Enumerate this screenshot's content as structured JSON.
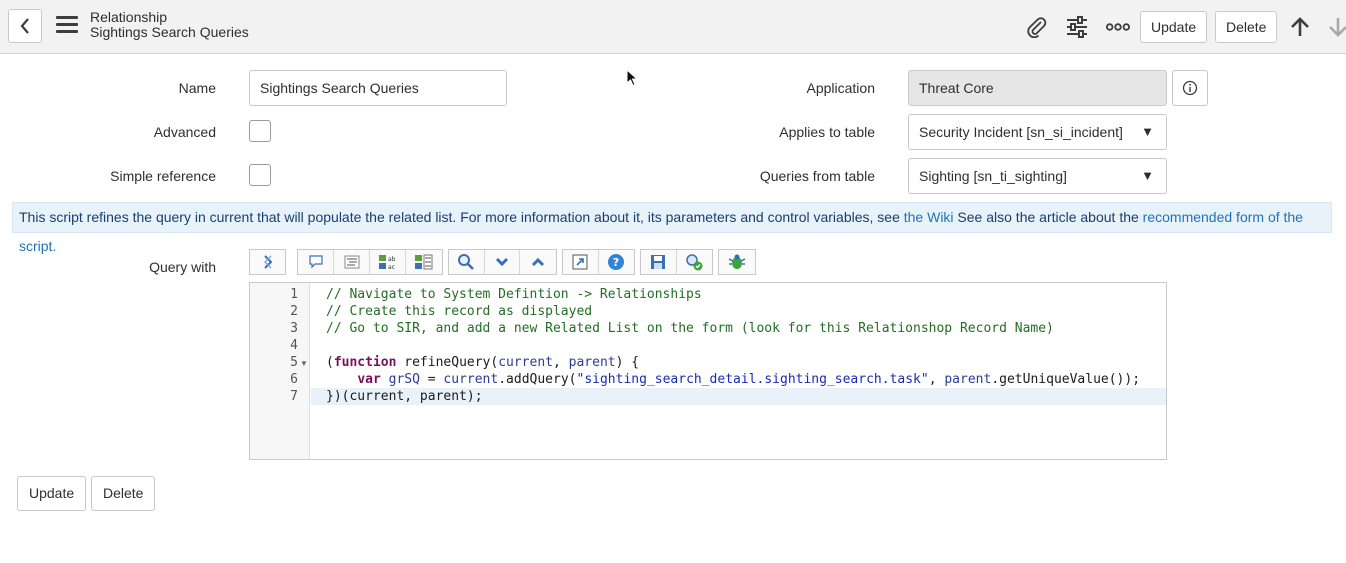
{
  "header": {
    "title_line1": "Relationship",
    "title_line2": "Sightings Search Queries",
    "update_label": "Update",
    "delete_label": "Delete",
    "icons": [
      "chevron-left-icon",
      "hamburger-menu-icon",
      "paperclip-icon",
      "sliders-icon",
      "more-icon",
      "arrow-up-icon",
      "arrow-down-icon"
    ]
  },
  "form": {
    "name_label": "Name",
    "name_value": "Sightings Search Queries",
    "advanced_label": "Advanced",
    "simple_reference_label": "Simple reference",
    "application_label": "Application",
    "application_value": "Threat Core",
    "applies_to_label": "Applies to table",
    "applies_to_value": "Security Incident [sn_si_incident]",
    "queries_from_label": "Queries from table",
    "queries_from_value": "Sighting [sn_ti_sighting]",
    "advanced_checked": false,
    "simple_reference_checked": false
  },
  "info": {
    "text1": "This script refines the query in current that will populate the related list. For more information about it, its parameters and control variables, see ",
    "link1": "the Wiki",
    "text2": " See also the article about the ",
    "link2": "recommended form of the script."
  },
  "editor": {
    "label": "Query with",
    "line_numbers": [
      "1",
      "2",
      "3",
      "4",
      "5",
      "6",
      "7"
    ],
    "toolbar_icons": [
      "toggle-editor-icon",
      "comment-icon",
      "format-icon",
      "replace-icon",
      "replace-all-icon",
      "search-icon",
      "find-next-icon",
      "find-prev-icon",
      "fullscreen-icon",
      "help-icon",
      "save-icon",
      "script-check-icon",
      "debug-icon"
    ]
  },
  "footer": {
    "update_label": "Update",
    "delete_label": "Delete"
  }
}
